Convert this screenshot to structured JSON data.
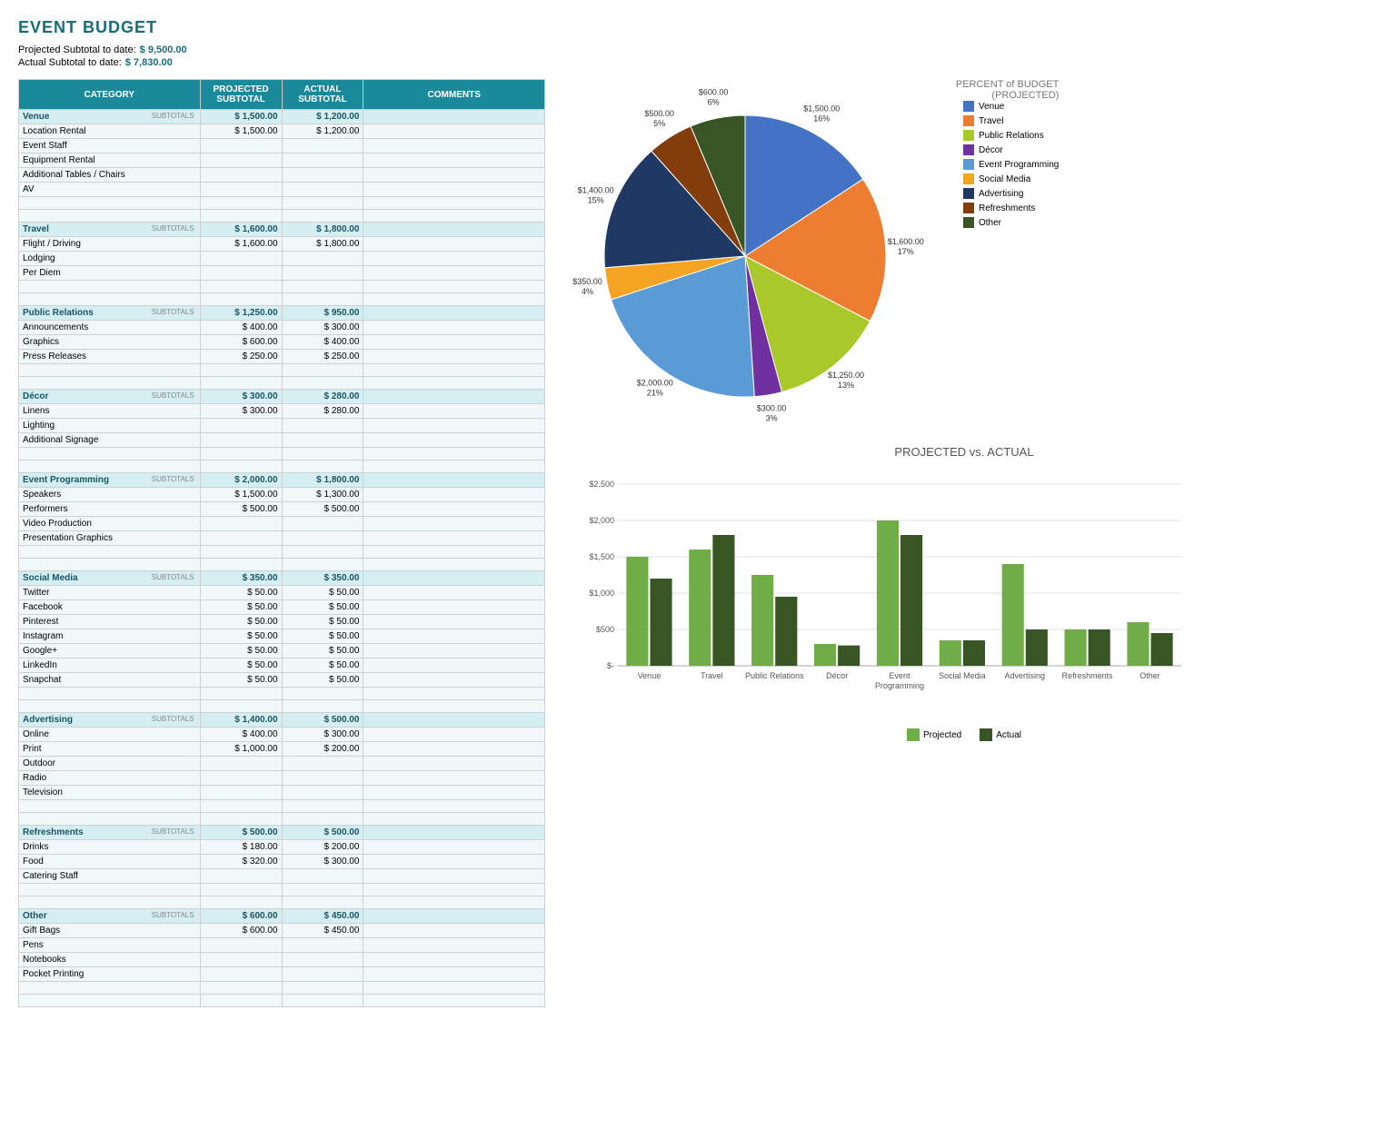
{
  "title": "EVENT BUDGET",
  "projected_subtotal_label": "Projected Subtotal to date:",
  "actual_subtotal_label": "Actual Subtotal to date:",
  "projected_subtotal_value": "$    9,500.00",
  "actual_subtotal_value": "$    7,830.00",
  "table": {
    "headers": [
      "CATEGORY",
      "PROJECTED\nSUBTOTAL",
      "ACTUAL\nSUBTOTAL",
      "COMMENTS"
    ],
    "sections": [
      {
        "name": "Venue",
        "projected": "$ 1,500.00",
        "actual": "$ 1,200.00",
        "items": [
          {
            "name": "Location Rental",
            "proj": "$ 1,500.00",
            "act": "$ 1,200.00"
          },
          {
            "name": "Event Staff",
            "proj": "",
            "act": ""
          },
          {
            "name": "Equipment Rental",
            "proj": "",
            "act": ""
          },
          {
            "name": "Additional Tables / Chairs",
            "proj": "",
            "act": ""
          },
          {
            "name": "AV",
            "proj": "",
            "act": ""
          }
        ]
      },
      {
        "name": "Travel",
        "projected": "$ 1,600.00",
        "actual": "$ 1,800.00",
        "items": [
          {
            "name": "Flight / Driving",
            "proj": "$ 1,600.00",
            "act": "$ 1,800.00"
          },
          {
            "name": "Lodging",
            "proj": "",
            "act": ""
          },
          {
            "name": "Per Diem",
            "proj": "",
            "act": ""
          }
        ]
      },
      {
        "name": "Public Relations",
        "projected": "$ 1,250.00",
        "actual": "$    950.00",
        "items": [
          {
            "name": "Announcements",
            "proj": "$ 400.00",
            "act": "$ 300.00"
          },
          {
            "name": "Graphics",
            "proj": "$ 600.00",
            "act": "$ 400.00"
          },
          {
            "name": "Press Releases",
            "proj": "$ 250.00",
            "act": "$ 250.00"
          }
        ]
      },
      {
        "name": "Décor",
        "projected": "$    300.00",
        "actual": "$    280.00",
        "items": [
          {
            "name": "Linens",
            "proj": "$ 300.00",
            "act": "$ 280.00"
          },
          {
            "name": "Lighting",
            "proj": "",
            "act": ""
          },
          {
            "name": "Additional Signage",
            "proj": "",
            "act": ""
          }
        ]
      },
      {
        "name": "Event Programming",
        "projected": "$ 2,000.00",
        "actual": "$ 1,800.00",
        "items": [
          {
            "name": "Speakers",
            "proj": "$ 1,500.00",
            "act": "$ 1,300.00"
          },
          {
            "name": "Performers",
            "proj": "$ 500.00",
            "act": "$ 500.00"
          },
          {
            "name": "Video Production",
            "proj": "",
            "act": ""
          },
          {
            "name": "Presentation Graphics",
            "proj": "",
            "act": ""
          }
        ]
      },
      {
        "name": "Social Media",
        "projected": "$    350.00",
        "actual": "$    350.00",
        "items": [
          {
            "name": "Twitter",
            "proj": "$ 50.00",
            "act": "$ 50.00"
          },
          {
            "name": "Facebook",
            "proj": "$ 50.00",
            "act": "$ 50.00"
          },
          {
            "name": "Pinterest",
            "proj": "$ 50.00",
            "act": "$ 50.00"
          },
          {
            "name": "Instagram",
            "proj": "$ 50.00",
            "act": "$ 50.00"
          },
          {
            "name": "Google+",
            "proj": "$ 50.00",
            "act": "$ 50.00"
          },
          {
            "name": "LinkedIn",
            "proj": "$ 50.00",
            "act": "$ 50.00"
          },
          {
            "name": "Snapchat",
            "proj": "$ 50.00",
            "act": "$ 50.00"
          }
        ]
      },
      {
        "name": "Advertising",
        "projected": "$ 1,400.00",
        "actual": "$    500.00",
        "items": [
          {
            "name": "Online",
            "proj": "$ 400.00",
            "act": "$ 300.00"
          },
          {
            "name": "Print",
            "proj": "$ 1,000.00",
            "act": "$ 200.00"
          },
          {
            "name": "Outdoor",
            "proj": "",
            "act": ""
          },
          {
            "name": "Radio",
            "proj": "",
            "act": ""
          },
          {
            "name": "Television",
            "proj": "",
            "act": ""
          }
        ]
      },
      {
        "name": "Refreshments",
        "projected": "$    500.00",
        "actual": "$    500.00",
        "items": [
          {
            "name": "Drinks",
            "proj": "$ 180.00",
            "act": "$ 200.00"
          },
          {
            "name": "Food",
            "proj": "$ 320.00",
            "act": "$ 300.00"
          },
          {
            "name": "Catering Staff",
            "proj": "",
            "act": ""
          }
        ]
      },
      {
        "name": "Other",
        "projected": "$    600.00",
        "actual": "$    450.00",
        "items": [
          {
            "name": "Gift Bags",
            "proj": "$ 600.00",
            "act": "$ 450.00"
          },
          {
            "name": "Pens",
            "proj": "",
            "act": ""
          },
          {
            "name": "Notebooks",
            "proj": "",
            "act": ""
          },
          {
            "name": "Pocket Printing",
            "proj": "",
            "act": ""
          }
        ]
      }
    ]
  },
  "pie_chart": {
    "title": "PERCENT of BUDGET",
    "subtitle": "(PROJECTED)",
    "slices": [
      {
        "label": "Venue",
        "value": 1500,
        "pct": 16,
        "color": "#4472C4"
      },
      {
        "label": "Travel",
        "value": 1600,
        "pct": 17,
        "color": "#ED7D31"
      },
      {
        "label": "Public Relations",
        "value": 1250,
        "pct": 13,
        "color": "#A9C92B"
      },
      {
        "label": "Décor",
        "value": 300,
        "pct": 3,
        "color": "#7030A0"
      },
      {
        "label": "Event Programming",
        "value": 2000,
        "pct": 21,
        "color": "#5B9BD5"
      },
      {
        "label": "Social Media",
        "value": 350,
        "pct": 4,
        "color": "#F4A422"
      },
      {
        "label": "Advertising",
        "value": 1400,
        "pct": 15,
        "color": "#1F3864"
      },
      {
        "label": "Refreshments",
        "value": 500,
        "pct": 5,
        "color": "#833C0B"
      },
      {
        "label": "Other",
        "value": 600,
        "pct": 6,
        "color": "#375623"
      }
    ]
  },
  "bar_chart": {
    "title": "PROJECTED vs. ACTUAL",
    "categories": [
      "Venue",
      "Travel",
      "Public Relations",
      "Décor",
      "Event\nProgramming",
      "Social Media",
      "Advertising",
      "Refreshments",
      "Other"
    ],
    "projected": [
      1500,
      1600,
      1250,
      300,
      2000,
      350,
      1400,
      500,
      600
    ],
    "actual": [
      1200,
      1800,
      950,
      280,
      1800,
      350,
      500,
      500,
      450
    ],
    "legend": [
      "Projected",
      "Actual"
    ],
    "proj_color": "#70AD47",
    "act_color": "#375623",
    "y_labels": [
      "$2,500",
      "$2,000",
      "$1,500",
      "$1,000",
      "$500",
      "$-"
    ]
  }
}
